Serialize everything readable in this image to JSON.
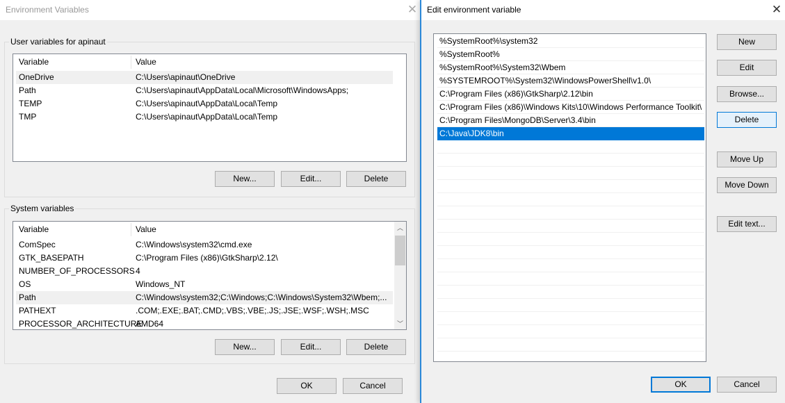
{
  "left_dialog": {
    "title": "Environment Variables",
    "user_group": {
      "label": "User variables for apinaut",
      "columns": [
        "Variable",
        "Value"
      ],
      "rows": [
        [
          "OneDrive",
          "C:\\Users\\apinaut\\OneDrive"
        ],
        [
          "Path",
          "C:\\Users\\apinaut\\AppData\\Local\\Microsoft\\WindowsApps;"
        ],
        [
          "TEMP",
          "C:\\Users\\apinaut\\AppData\\Local\\Temp"
        ],
        [
          "TMP",
          "C:\\Users\\apinaut\\AppData\\Local\\Temp"
        ]
      ],
      "buttons": [
        "New...",
        "Edit...",
        "Delete"
      ]
    },
    "system_group": {
      "label": "System variables",
      "columns": [
        "Variable",
        "Value"
      ],
      "rows": [
        [
          "ComSpec",
          "C:\\Windows\\system32\\cmd.exe"
        ],
        [
          "GTK_BASEPATH",
          "C:\\Program Files (x86)\\GtkSharp\\2.12\\"
        ],
        [
          "NUMBER_OF_PROCESSORS",
          "4"
        ],
        [
          "OS",
          "Windows_NT"
        ],
        [
          "Path",
          "C:\\Windows\\system32;C:\\Windows;C:\\Windows\\System32\\Wbem;..."
        ],
        [
          "PATHEXT",
          ".COM;.EXE;.BAT;.CMD;.VBS;.VBE;.JS;.JSE;.WSF;.WSH;.MSC"
        ],
        [
          "PROCESSOR_ARCHITECTURE",
          "AMD64"
        ]
      ],
      "buttons": [
        "New...",
        "Edit...",
        "Delete"
      ]
    },
    "ok": "OK",
    "cancel": "Cancel"
  },
  "right_dialog": {
    "title": "Edit environment variable",
    "paths": [
      "%SystemRoot%\\system32",
      "%SystemRoot%",
      "%SystemRoot%\\System32\\Wbem",
      "%SYSTEMROOT%\\System32\\WindowsPowerShell\\v1.0\\",
      "C:\\Program Files (x86)\\GtkSharp\\2.12\\bin",
      "C:\\Program Files (x86)\\Windows Kits\\10\\Windows Performance Toolkit\\",
      "C:\\Program Files\\MongoDB\\Server\\3.4\\bin",
      "C:\\Java\\JDK8\\bin"
    ],
    "selected_index": 7,
    "buttons": {
      "new": "New",
      "edit": "Edit",
      "browse": "Browse...",
      "delete": "Delete",
      "move_up": "Move Up",
      "move_down": "Move Down",
      "edit_text": "Edit text..."
    },
    "ok": "OK",
    "cancel": "Cancel"
  },
  "colors": {
    "accent": "#0078d7",
    "button": "#e1e1e1",
    "background": "#f0f0f0"
  }
}
